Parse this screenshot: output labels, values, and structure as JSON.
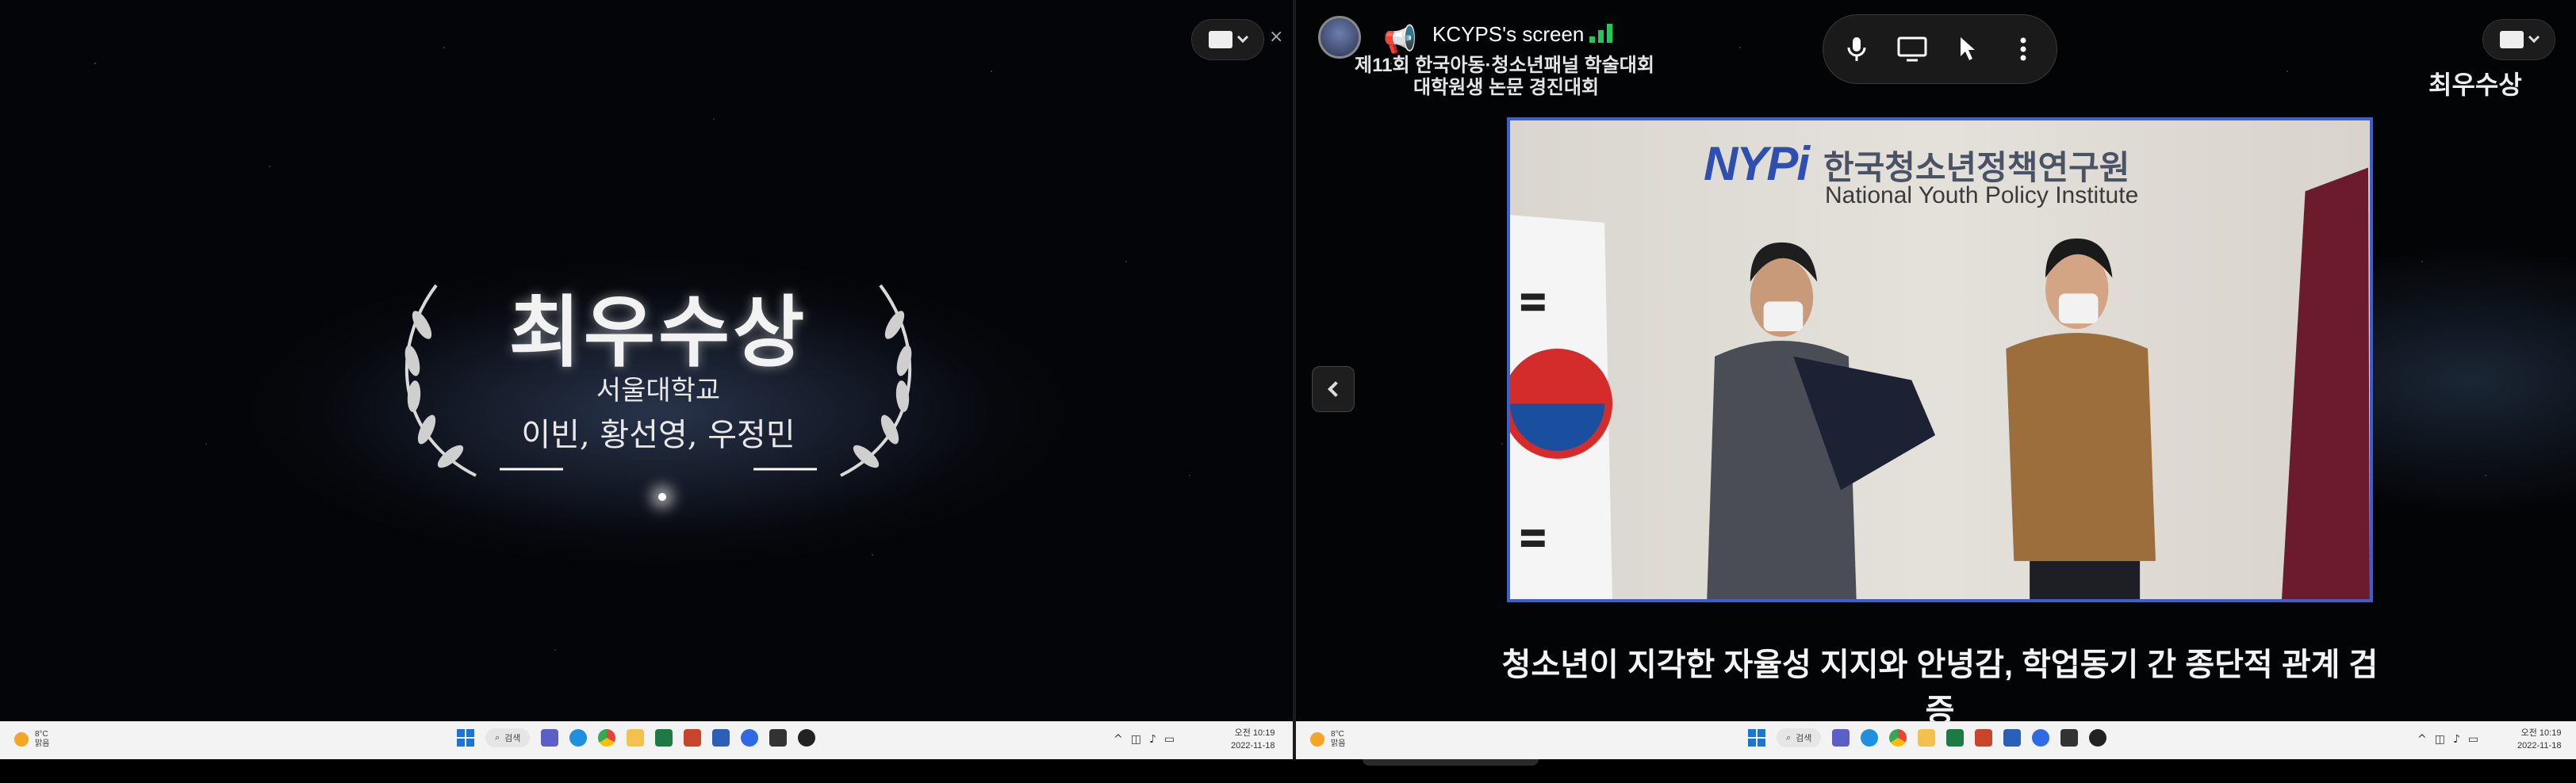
{
  "left": {
    "award_title": "최우수상",
    "school": "서울대학교",
    "names": "이빈, 황선영, 우정민",
    "close_label": "×"
  },
  "right": {
    "sharer_name": "KCYPS's screen",
    "event_line1": "제11회 한국아동·청소년패널 학술대회",
    "event_line2": "대학원생 논문 경진대회",
    "slide_title": "최우수상",
    "logo_mark": "NYPi",
    "logo_ko": "한국청소년정책연구원",
    "logo_en": "National Youth Policy Institute",
    "caption": "청소년이 지각한 자율성 지지와 안녕감, 학업동기 간 종단적 관계 검증",
    "toolbar": {
      "mic_icon": "microphone-icon",
      "screen_icon": "monitor-icon",
      "pointer_icon": "pointer-icon",
      "more_icon": "more-vertical-icon"
    }
  },
  "taskbar": {
    "weather_temp": "8°C",
    "weather_cond": "맑음",
    "search_label": "검색",
    "time": "오전 10:19",
    "date": "2022-11-18"
  },
  "colors": {
    "photo_border": "#3a5fd0",
    "signal_green": "#22c55e",
    "windows_blue": "#1877d6"
  }
}
